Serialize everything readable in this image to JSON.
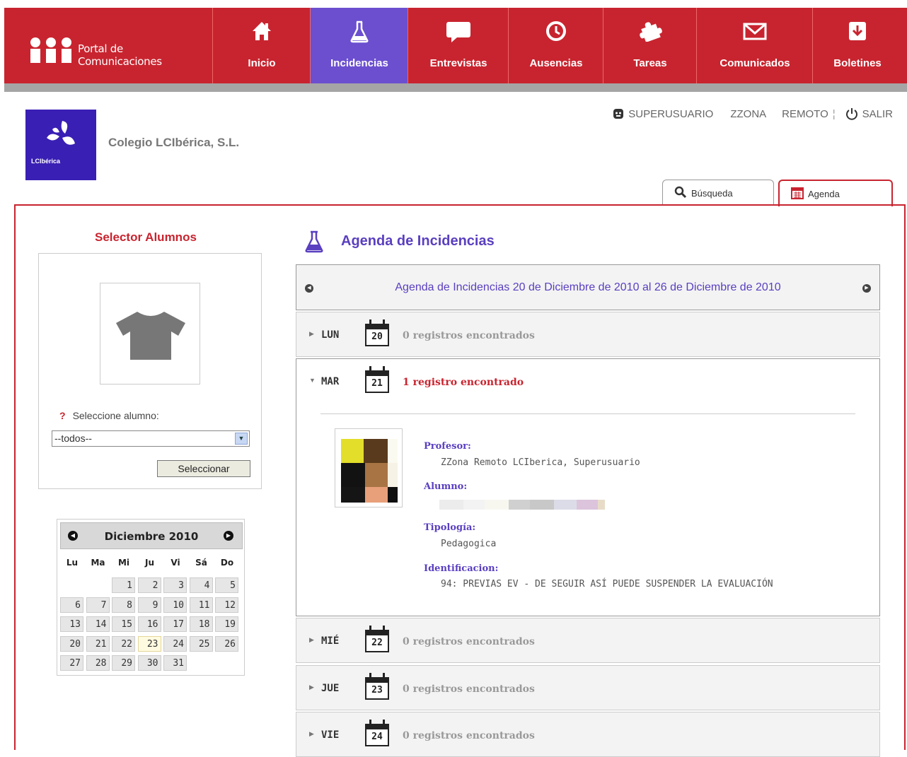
{
  "portal": {
    "title_line1": "Portal de",
    "title_line2": "Comunicaciones"
  },
  "nav": [
    {
      "label": "Inicio",
      "icon": "home-icon"
    },
    {
      "label": "Incidencias",
      "icon": "flask-icon",
      "active": true
    },
    {
      "label": "Entrevistas",
      "icon": "speech-bubble-icon"
    },
    {
      "label": "Ausencias",
      "icon": "clock-icon"
    },
    {
      "label": "Tareas",
      "icon": "puzzle-icon"
    },
    {
      "label": "Comunicados",
      "icon": "envelope-icon"
    },
    {
      "label": "Boletines",
      "icon": "download-icon"
    }
  ],
  "school": {
    "name": "Colegio LCIbérica, S.L.",
    "brand": "LCIbérica"
  },
  "user": {
    "name": "SUPERUSUARIO",
    "zone": "ZZONA",
    "remote": "REMOTO",
    "separator": "¦",
    "logout": "SALIR"
  },
  "tabs": {
    "search": "Búsqueda",
    "agenda": "Agenda"
  },
  "selector": {
    "title": "Selector Alumnos",
    "help_mark": "?",
    "label": "Seleccione alumno:",
    "selected": "--todos--",
    "button": "Seleccionar"
  },
  "calendar": {
    "title": "Diciembre 2010",
    "dow": [
      "Lu",
      "Ma",
      "Mi",
      "Ju",
      "Vi",
      "Sá",
      "Do"
    ],
    "weeks": [
      [
        "",
        "",
        "1",
        "2",
        "3",
        "4",
        "5"
      ],
      [
        "6",
        "7",
        "8",
        "9",
        "10",
        "11",
        "12"
      ],
      [
        "13",
        "14",
        "15",
        "16",
        "17",
        "18",
        "19"
      ],
      [
        "20",
        "21",
        "22",
        "23",
        "24",
        "25",
        "26"
      ],
      [
        "27",
        "28",
        "29",
        "30",
        "31",
        "",
        ""
      ]
    ],
    "today": "23"
  },
  "agenda": {
    "title": "Agenda de Incidencias",
    "week_range": "Agenda de Incidencias 20 de Diciembre de 2010 al 26 de Diciembre de 2010",
    "days": [
      {
        "name": "LUN",
        "date": "20",
        "count": "0 registros encontrados",
        "open": false
      },
      {
        "name": "MAR",
        "date": "21",
        "count": "1 registro encontrado",
        "open": true
      },
      {
        "name": "MIÉ",
        "date": "22",
        "count": "0 registros encontrados",
        "open": false
      },
      {
        "name": "JUE",
        "date": "23",
        "count": "0 registros encontrados",
        "open": false
      },
      {
        "name": "VIE",
        "date": "24",
        "count": "0 registros encontrados",
        "open": false
      }
    ],
    "record": {
      "profesor_label": "Profesor:",
      "profesor": "ZZona Remoto LCIberica, Superusuario",
      "alumno_label": "Alumno:",
      "tipologia_label": "Tipología:",
      "tipologia": "Pedagogica",
      "identificacion_label": "Identificacion:",
      "identificacion": "94: PREVIAS EV - DE SEGUIR ASÍ PUEDE SUSPENDER LA EVALUACIÓN"
    }
  },
  "colors": {
    "brand_red": "#c8242f",
    "active_purple": "#6b4fcf",
    "accent_purple": "#5a3fc0"
  }
}
